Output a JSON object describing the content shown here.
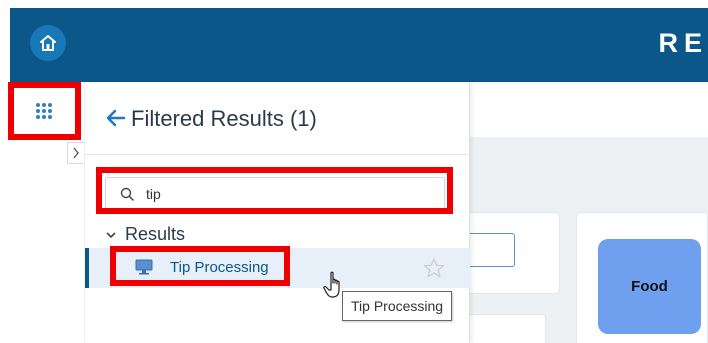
{
  "app": {
    "brand_text": "RE",
    "accent_color": "#0b5789",
    "header_color": "#0b5789",
    "highlight_color": "#ee0000"
  },
  "header": {
    "home_icon": "home-icon"
  },
  "left_rail": {
    "apps_icon": "grid-dots-icon",
    "collapse_icon": "chevron-right-icon"
  },
  "panel": {
    "title": "Filtered Results (1)",
    "back_icon": "arrow-left-icon",
    "search": {
      "value": "tip",
      "icon": "search-icon"
    },
    "results_label": "Results",
    "results": [
      {
        "label": "Tip Processing",
        "icon": "monitor-icon",
        "favorite_icon": "star-outline-icon",
        "selected": true
      }
    ]
  },
  "background": {
    "tile_label": "Food",
    "tile_color": "#6fa0ef"
  },
  "tooltip": {
    "text": "Tip Processing"
  }
}
